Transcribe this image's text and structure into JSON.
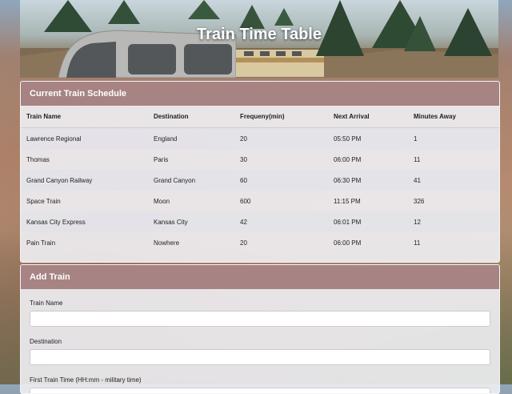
{
  "header": {
    "title": "Train Time Table"
  },
  "schedule": {
    "title": "Current Train Schedule",
    "columns": [
      "Train Name",
      "Destination",
      "Frequeny(min)",
      "Next Arrival",
      "Minutes Away"
    ],
    "rows": [
      [
        "Lawrence Regional",
        "England",
        "20",
        "05:50 PM",
        "1"
      ],
      [
        "Thomas",
        "Paris",
        "30",
        "06:00 PM",
        "11"
      ],
      [
        "Grand Canyon Railway",
        "Grand Canyon",
        "60",
        "06:30 PM",
        "41"
      ],
      [
        "Space Train",
        "Moon",
        "600",
        "11:15 PM",
        "326"
      ],
      [
        "Kansas City Express",
        "Kansas City",
        "42",
        "06:01 PM",
        "12"
      ],
      [
        "Pain Train",
        "Nowhere",
        "20",
        "06:00 PM",
        "11"
      ]
    ]
  },
  "add_train": {
    "title": "Add Train",
    "fields": {
      "name_label": "Train Name",
      "destination_label": "Destination",
      "first_time_label": "First Train Time (HH:mm - military time)"
    }
  }
}
